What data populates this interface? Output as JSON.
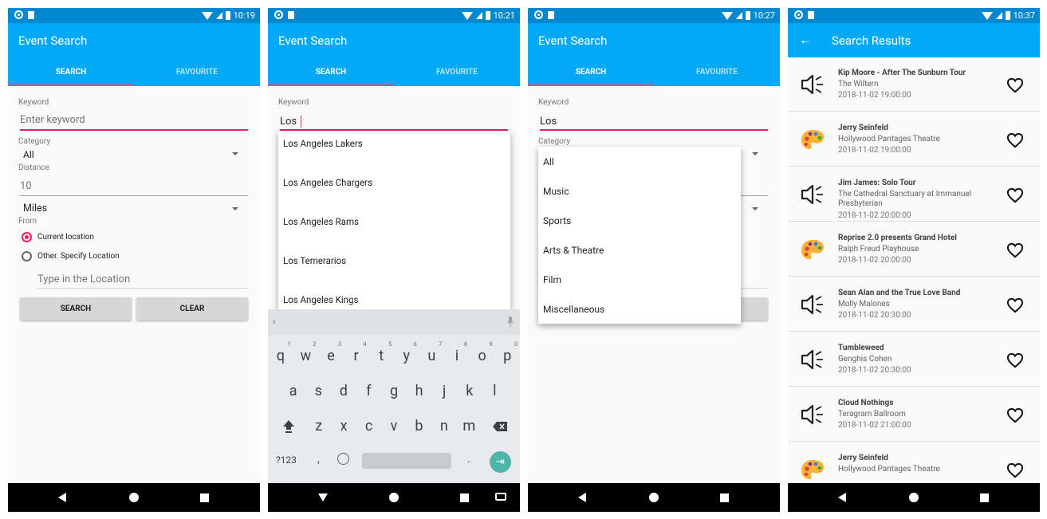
{
  "status_bar": {
    "times": [
      "10:19",
      "10:21",
      "10:27",
      "10:37"
    ]
  },
  "app_title": "Event Search",
  "tabs": {
    "search": "SEARCH",
    "favourite": "FAVOURITE"
  },
  "form": {
    "keyword_label": "Keyword",
    "keyword_placeholder": "Enter keyword",
    "keyword_value": "Los",
    "category_label": "Category",
    "category_value": "All",
    "distance_label": "Distance",
    "distance_placeholder": "10",
    "units_value": "Miles",
    "from_label": "From",
    "radio_current": "Current location",
    "radio_other": "Other. Specify Location",
    "location_placeholder": "Type in the Location",
    "search_button": "SEARCH",
    "clear_button": "CLEAR"
  },
  "autocomplete": [
    "Los Angeles Lakers",
    "Los Angeles Chargers",
    "Los Angeles Rams",
    "Los Temerarios",
    "Los Angeles Kings"
  ],
  "category_options": [
    "All",
    "Music",
    "Sports",
    "Arts & Theatre",
    "Film",
    "Miscellaneous"
  ],
  "keyboard": {
    "row1": [
      "q",
      "w",
      "e",
      "r",
      "t",
      "y",
      "u",
      "i",
      "o",
      "p"
    ],
    "row1_nums": [
      "1",
      "2",
      "3",
      "4",
      "5",
      "6",
      "7",
      "8",
      "9",
      "0"
    ],
    "row2": [
      "a",
      "s",
      "d",
      "f",
      "g",
      "h",
      "j",
      "k",
      "l"
    ],
    "row3": [
      "z",
      "x",
      "c",
      "v",
      "b",
      "n",
      "m"
    ],
    "sym": "?123",
    "comma": ",",
    "period": "."
  },
  "results_title": "Search Results",
  "results": [
    {
      "title": "Kip Moore - After The Sunburn Tour",
      "venue": "The Wiltern",
      "date": "2018-11-02 19:00:00",
      "icon": "music-speaker-icon"
    },
    {
      "title": "Jerry Seinfeld",
      "venue": "Hollywood Pantages Theatre",
      "date": "2018-11-02 19:00:00",
      "icon": "arts-palette-icon"
    },
    {
      "title": "Jim James: Solo Tour",
      "venue": "The Cathedral Sanctuary at Immanuel Presbyterian",
      "date": "2018-11-02 20:00:00",
      "icon": "music-speaker-icon"
    },
    {
      "title": "Reprise 2.0 presents Grand Hotel",
      "venue": "Ralph Freud Playhouse",
      "date": "2018-11-02 20:00:00",
      "icon": "arts-palette-icon"
    },
    {
      "title": "Sean Alan and the True Love Band",
      "venue": "Molly Malones",
      "date": "2018-11-02 20:30:00",
      "icon": "music-speaker-icon"
    },
    {
      "title": "Tumbleweed",
      "venue": "Genghis Cohen",
      "date": "2018-11-02 20:30:00",
      "icon": "music-speaker-icon"
    },
    {
      "title": "Cloud Nothings",
      "venue": "Teragram Ballroom",
      "date": "2018-11-02 21:00:00",
      "icon": "music-speaker-icon"
    },
    {
      "title": "Jerry Seinfeld",
      "venue": "Hollywood Pantages Theatre",
      "date": "",
      "icon": "arts-palette-icon"
    }
  ],
  "colors": {
    "primary": "#03a9f4",
    "primary_dark": "#0288d1",
    "accent": "#ff4081"
  }
}
